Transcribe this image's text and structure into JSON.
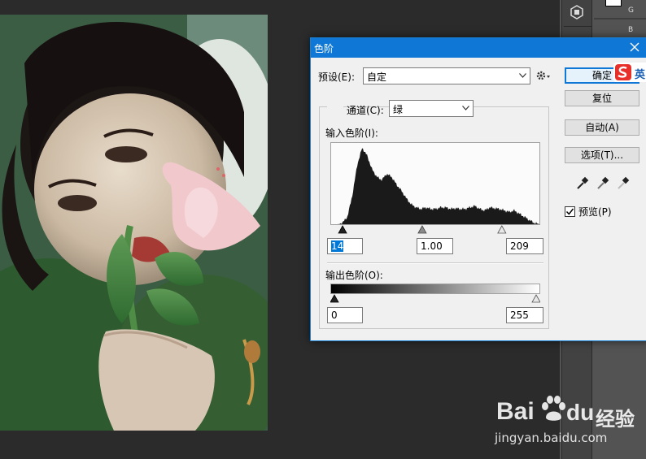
{
  "dialog": {
    "title": "色阶",
    "preset_label": "预设(E):",
    "preset_value": "自定",
    "channel_label": "通道(C):",
    "channel_value": "绿",
    "input_levels_label": "输入色阶(I):",
    "input_black": "14",
    "input_gamma": "1.00",
    "input_white": "209",
    "output_levels_label": "输出色阶(O):",
    "output_black": "0",
    "output_white": "255",
    "preview_label": "预览(P)",
    "preview_checked": true
  },
  "buttons": {
    "ok": "确定",
    "reset": "复位",
    "auto": "自动(A)",
    "options": "选项(T)..."
  },
  "ime_badge": {
    "text": "英"
  },
  "right_panel": {
    "channels": [
      "G",
      "B"
    ]
  },
  "watermark": {
    "brand_left": "Bai",
    "brand_right": "du",
    "product": "经验",
    "url": "jingyan.baidu.com"
  },
  "icons": {
    "close": "close-icon",
    "gear": "gear-icon",
    "dropdown": "chevron-down-icon",
    "eyedropper": "eyedropper-icon",
    "paw": "baidu-paw-icon"
  },
  "colors": {
    "accent": "#0f78d7",
    "histogram": "#1a1a1a",
    "sogou": "#e8302b"
  },
  "chart_data": {
    "type": "area",
    "description_free": true,
    "x_range": [
      0,
      255
    ],
    "samples_x": [
      0,
      8,
      14,
      20,
      26,
      32,
      38,
      44,
      50,
      56,
      62,
      68,
      74,
      80,
      86,
      92,
      98,
      104,
      110,
      116,
      122,
      128,
      134,
      140,
      146,
      152,
      158,
      164,
      170,
      176,
      182,
      188,
      194,
      200,
      206,
      212,
      218,
      224,
      230,
      236,
      242,
      248,
      255
    ],
    "samples_y": [
      0,
      0,
      2,
      10,
      38,
      78,
      100,
      90,
      72,
      62,
      58,
      66,
      62,
      52,
      44,
      34,
      26,
      22,
      20,
      22,
      20,
      20,
      22,
      22,
      20,
      21,
      20,
      20,
      22,
      24,
      20,
      18,
      22,
      21,
      20,
      18,
      16,
      18,
      14,
      10,
      6,
      2,
      0
    ],
    "y_range": [
      0,
      100
    ]
  }
}
